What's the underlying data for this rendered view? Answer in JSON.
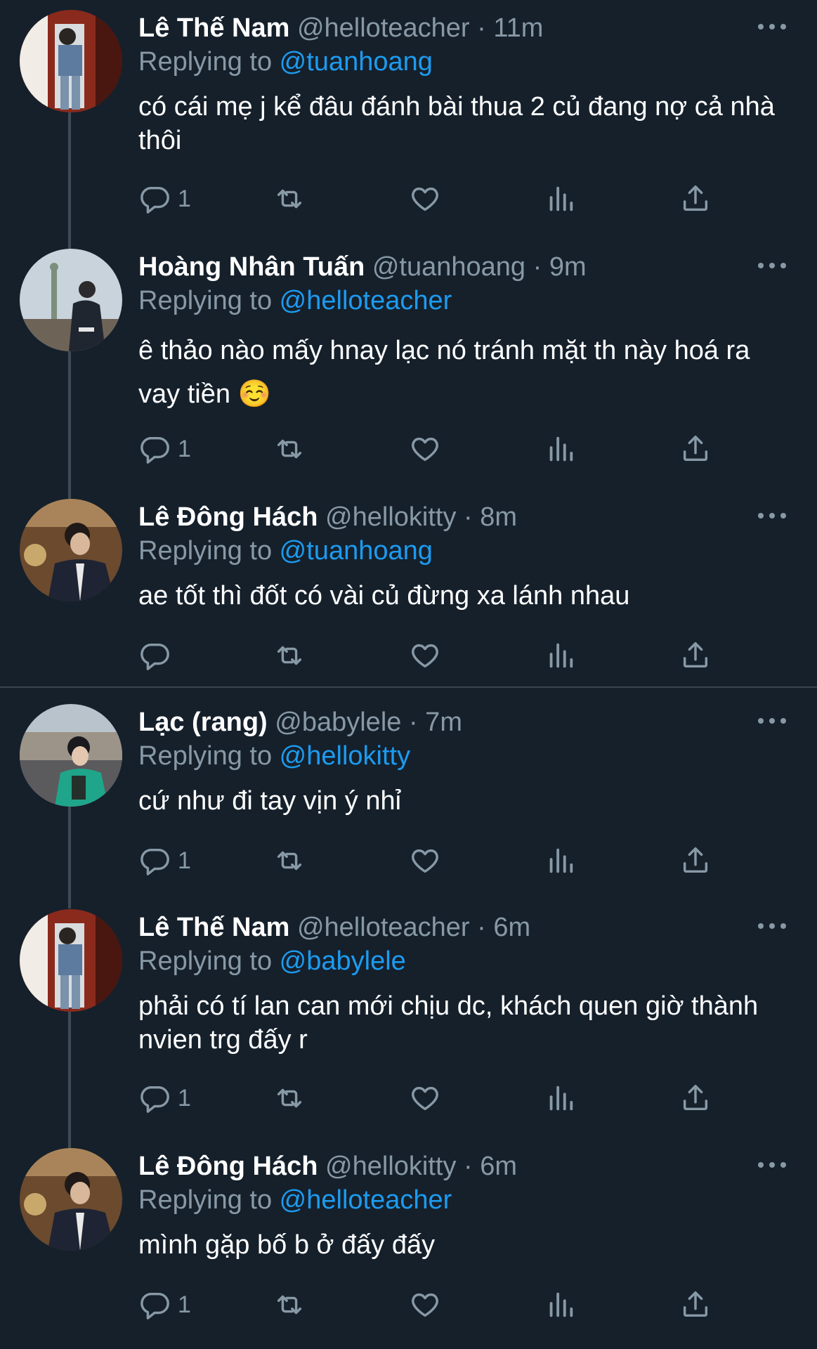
{
  "tweets": [
    {
      "name": "Lê Thế Nam",
      "handle": "@helloteacher",
      "time": "· 11m",
      "replying_label": "Replying to ",
      "replying_handle": "@tuanhoang",
      "text": "có cái mẹ j kể đâu đánh bài thua 2 củ đang nợ cả nhà thôi",
      "reply_count": "1"
    },
    {
      "name": "Hoàng Nhân Tuấn",
      "handle": "@tuanhoang",
      "time": "· 9m",
      "replying_label": "Replying to ",
      "replying_handle": "@helloteacher",
      "text": "ê thảo nào mấy hnay lạc nó tránh mặt th này hoá ra vay tiền ☺️",
      "reply_count": "1"
    },
    {
      "name": "Lê Đông Hách",
      "handle": "@hellokitty",
      "time": "· 8m",
      "replying_label": "Replying to ",
      "replying_handle": "@tuanhoang",
      "text": "ae tốt thì đốt có vài củ đừng xa lánh nhau",
      "reply_count": ""
    },
    {
      "name": "Lạc (rang)",
      "handle": "@babylele",
      "time": "· 7m",
      "replying_label": "Replying to ",
      "replying_handle": "@hellokitty",
      "text": "cứ như đi tay vịn ý nhỉ",
      "reply_count": "1"
    },
    {
      "name": "Lê Thế Nam",
      "handle": "@helloteacher",
      "time": "· 6m",
      "replying_label": "Replying to ",
      "replying_handle": "@babylele",
      "text": "phải có tí lan can mới chịu dc, khách quen giờ thành nvien trg đấy r",
      "reply_count": "1"
    },
    {
      "name": "Lê Đông Hách",
      "handle": "@hellokitty",
      "time": "· 6m",
      "replying_label": "Replying to ",
      "replying_handle": "@helloteacher",
      "text": "mình gặp bố b ở đấy đấy",
      "reply_count": "1"
    }
  ],
  "icons": {
    "reply": "reply-icon",
    "retweet": "retweet-icon",
    "like": "heart-icon",
    "views": "views-icon",
    "share": "share-icon",
    "more": "more-icon"
  },
  "colors": {
    "background": "#15202b",
    "secondary_text": "#8899a6",
    "link": "#1d9bf0"
  }
}
